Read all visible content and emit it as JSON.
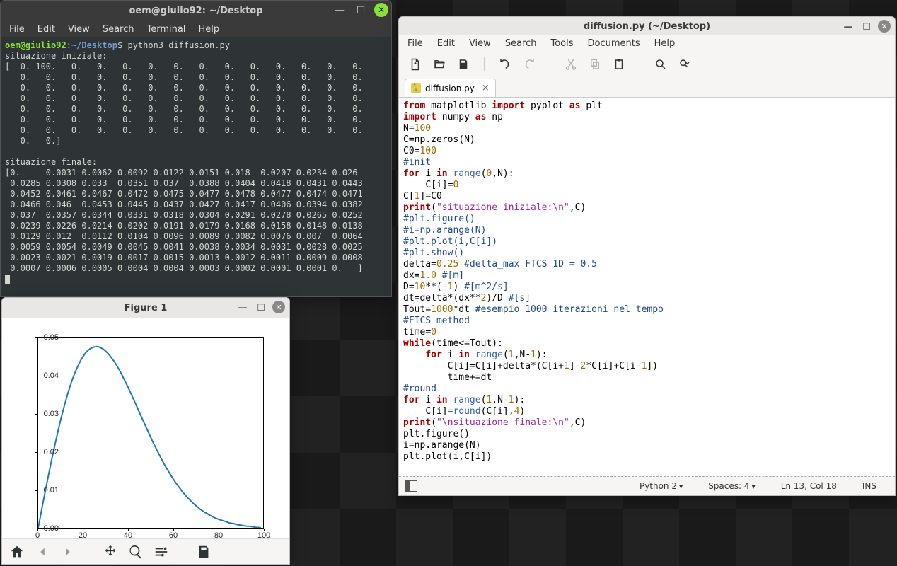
{
  "terminal": {
    "title": "oem@giulio92: ~/Desktop",
    "menu": [
      "File",
      "Edit",
      "View",
      "Search",
      "Terminal",
      "Help"
    ],
    "prompt_user": "oem@giulio92",
    "prompt_path": "~/Desktop",
    "prompt_symbol": "$",
    "command": "python3 diffusion.py",
    "out_label1": "situazione iniziale:",
    "init_array": "[  0. 100.   0.   0.   0.   0.   0.   0.   0.   0.   0.   0.   0.   0.\n   0.   0.   0.   0.   0.   0.   0.   0.   0.   0.   0.   0.   0.   0.\n   0.   0.   0.   0.   0.   0.   0.   0.   0.   0.   0.   0.   0.   0.\n   0.   0.   0.   0.   0.   0.   0.   0.   0.   0.   0.   0.   0.   0.\n   0.   0.   0.   0.   0.   0.   0.   0.   0.   0.   0.   0.   0.   0.\n   0.   0.   0.   0.   0.   0.   0.   0.   0.   0.   0.   0.   0.   0.\n   0.   0.   0.   0.   0.   0.   0.   0.   0.   0.   0.   0.   0.   0.\n   0.   0.]",
    "out_label2": "situazione finale:",
    "final_array": "[0.     0.0031 0.0062 0.0092 0.0122 0.0151 0.018  0.0207 0.0234 0.026\n 0.0285 0.0308 0.033  0.0351 0.037  0.0388 0.0404 0.0418 0.0431 0.0443\n 0.0452 0.0461 0.0467 0.0472 0.0475 0.0477 0.0478 0.0477 0.0474 0.0471\n 0.0466 0.046  0.0453 0.0445 0.0437 0.0427 0.0417 0.0406 0.0394 0.0382\n 0.037  0.0357 0.0344 0.0331 0.0318 0.0304 0.0291 0.0278 0.0265 0.0252\n 0.0239 0.0226 0.0214 0.0202 0.0191 0.0179 0.0168 0.0158 0.0148 0.0138\n 0.0129 0.012  0.0112 0.0104 0.0096 0.0089 0.0082 0.0076 0.007  0.0064\n 0.0059 0.0054 0.0049 0.0045 0.0041 0.0038 0.0034 0.0031 0.0028 0.0025\n 0.0023 0.0021 0.0019 0.0017 0.0015 0.0013 0.0012 0.0011 0.0009 0.0008\n 0.0007 0.0006 0.0005 0.0004 0.0004 0.0003 0.0002 0.0001 0.0001 0.   ]"
  },
  "chart_data": {
    "type": "line",
    "x": [
      0,
      1,
      2,
      3,
      4,
      5,
      6,
      7,
      8,
      9,
      10,
      11,
      12,
      13,
      14,
      15,
      16,
      17,
      18,
      19,
      20,
      21,
      22,
      23,
      24,
      25,
      26,
      27,
      28,
      29,
      30,
      31,
      32,
      33,
      34,
      35,
      36,
      37,
      38,
      39,
      40,
      41,
      42,
      43,
      44,
      45,
      46,
      47,
      48,
      49,
      50,
      51,
      52,
      53,
      54,
      55,
      56,
      57,
      58,
      59,
      60,
      61,
      62,
      63,
      64,
      65,
      66,
      67,
      68,
      69,
      70,
      71,
      72,
      73,
      74,
      75,
      76,
      77,
      78,
      79,
      80,
      81,
      82,
      83,
      84,
      85,
      86,
      87,
      88,
      89,
      90,
      91,
      92,
      93,
      94,
      95,
      96,
      97,
      98,
      99
    ],
    "y": [
      0,
      0.0031,
      0.0062,
      0.0092,
      0.0122,
      0.0151,
      0.018,
      0.0207,
      0.0234,
      0.026,
      0.0285,
      0.0308,
      0.033,
      0.0351,
      0.037,
      0.0388,
      0.0404,
      0.0418,
      0.0431,
      0.0443,
      0.0452,
      0.0461,
      0.0467,
      0.0472,
      0.0475,
      0.0477,
      0.0478,
      0.0477,
      0.0474,
      0.0471,
      0.0466,
      0.046,
      0.0453,
      0.0445,
      0.0437,
      0.0427,
      0.0417,
      0.0406,
      0.0394,
      0.0382,
      0.037,
      0.0357,
      0.0344,
      0.0331,
      0.0318,
      0.0304,
      0.0291,
      0.0278,
      0.0265,
      0.0252,
      0.0239,
      0.0226,
      0.0214,
      0.0202,
      0.0191,
      0.0179,
      0.0168,
      0.0158,
      0.0148,
      0.0138,
      0.0129,
      0.012,
      0.0112,
      0.0104,
      0.0096,
      0.0089,
      0.0082,
      0.0076,
      0.007,
      0.0064,
      0.0059,
      0.0054,
      0.0049,
      0.0045,
      0.0041,
      0.0038,
      0.0034,
      0.0031,
      0.0028,
      0.0025,
      0.0023,
      0.0021,
      0.0019,
      0.0017,
      0.0015,
      0.0013,
      0.0012,
      0.0011,
      0.0009,
      0.0008,
      0.0007,
      0.0006,
      0.0005,
      0.0004,
      0.0004,
      0.0003,
      0.0002,
      0.0001,
      0.0001,
      0
    ],
    "title": "Figure 1",
    "xlabel": "",
    "ylabel": "",
    "xlim": [
      0,
      100
    ],
    "ylim": [
      0,
      0.05
    ],
    "xticks": [
      0,
      20,
      40,
      60,
      80,
      100
    ],
    "yticks": [
      0.0,
      0.01,
      0.02,
      0.03,
      0.04,
      0.05
    ],
    "ytick_labels": [
      "0.00",
      "0.01",
      "0.02",
      "0.03",
      "0.04",
      "0.05"
    ],
    "xtick_labels": [
      "0",
      "20",
      "40",
      "60",
      "80",
      "100"
    ],
    "line_color": "#1f77b4"
  },
  "figure": {
    "title": "Figure 1",
    "toolbar_icons": [
      "home",
      "back",
      "forward",
      "move",
      "zoom",
      "config",
      "save"
    ]
  },
  "editor": {
    "title": "diffusion.py (~/Desktop)",
    "menu": [
      "File",
      "Edit",
      "View",
      "Search",
      "Tools",
      "Documents",
      "Help"
    ],
    "tab_label": "diffusion.py",
    "status": {
      "language": "Python 2",
      "indent": "Spaces: 4",
      "cursor": "Ln 13, Col 18",
      "insmode": "INS"
    },
    "code_tokens": [
      [
        [
          "kw",
          "from"
        ],
        [
          "sp",
          " "
        ],
        [
          "id",
          "matplotlib"
        ],
        [
          "sp",
          " "
        ],
        [
          "kw",
          "import"
        ],
        [
          "sp",
          " "
        ],
        [
          "id",
          "pyplot"
        ],
        [
          "sp",
          " "
        ],
        [
          "kw",
          "as"
        ],
        [
          "sp",
          " "
        ],
        [
          "id",
          "plt"
        ]
      ],
      [
        [
          "kw",
          "import"
        ],
        [
          "sp",
          " "
        ],
        [
          "id",
          "numpy"
        ],
        [
          "sp",
          " "
        ],
        [
          "kw",
          "as"
        ],
        [
          "sp",
          " "
        ],
        [
          "id",
          "np"
        ]
      ],
      [
        [
          "id",
          "N"
        ],
        [
          "op",
          "="
        ],
        [
          "num",
          "100"
        ]
      ],
      [
        [
          "id",
          "C"
        ],
        [
          "op",
          "="
        ],
        [
          "id",
          "np.zeros(N)"
        ]
      ],
      [
        [
          "id",
          "C0"
        ],
        [
          "op",
          "="
        ],
        [
          "num",
          "100"
        ]
      ],
      [
        [
          "cm",
          "#init"
        ]
      ],
      [
        [
          "kw",
          "for"
        ],
        [
          "sp",
          " "
        ],
        [
          "id",
          "i"
        ],
        [
          "sp",
          " "
        ],
        [
          "kw",
          "in"
        ],
        [
          "sp",
          " "
        ],
        [
          "bi",
          "range"
        ],
        [
          "op",
          "("
        ],
        [
          "num",
          "0"
        ],
        [
          "op",
          ",N):"
        ]
      ],
      [
        [
          "sp",
          "    "
        ],
        [
          "id",
          "C[i]"
        ],
        [
          "op",
          "="
        ],
        [
          "num",
          "0"
        ]
      ],
      [
        [
          "id",
          "C["
        ],
        [
          "num",
          "1"
        ],
        [
          "id",
          "]"
        ],
        [
          "op",
          "="
        ],
        [
          "id",
          "C0"
        ]
      ],
      [
        [
          "kw",
          "print"
        ],
        [
          "op",
          "("
        ],
        [
          "str",
          "\"situazione iniziale:\\n\""
        ],
        [
          "op",
          ",C)"
        ]
      ],
      [
        [
          "cm",
          "#plt.figure()"
        ]
      ],
      [
        [
          "cm",
          "#i=np.arange(N)"
        ]
      ],
      [
        [
          "cm",
          "#plt.plot(i,C[i])"
        ]
      ],
      [
        [
          "cm",
          "#plt.show()"
        ]
      ],
      [
        [
          "id",
          "delta"
        ],
        [
          "op",
          "="
        ],
        [
          "num",
          "0.25"
        ],
        [
          "sp",
          " "
        ],
        [
          "cm",
          "#delta_max FTCS 1D = 0.5"
        ]
      ],
      [
        [
          "id",
          "dx"
        ],
        [
          "op",
          "="
        ],
        [
          "num",
          "1.0"
        ],
        [
          "sp",
          " "
        ],
        [
          "cm",
          "#[m]"
        ]
      ],
      [
        [
          "id",
          "D"
        ],
        [
          "op",
          "="
        ],
        [
          "num",
          "10"
        ],
        [
          "op",
          "**(-"
        ],
        [
          "num",
          "1"
        ],
        [
          "op",
          ")"
        ],
        [
          "sp",
          " "
        ],
        [
          "cm",
          "#[m^2/s]"
        ]
      ],
      [
        [
          "id",
          "dt"
        ],
        [
          "op",
          "="
        ],
        [
          "id",
          "delta*(dx**"
        ],
        [
          "num",
          "2"
        ],
        [
          "id",
          ")/D"
        ],
        [
          "sp",
          " "
        ],
        [
          "cm",
          "#[s]"
        ]
      ],
      [
        [
          "id",
          "Tout"
        ],
        [
          "op",
          "="
        ],
        [
          "num",
          "1000"
        ],
        [
          "id",
          "*dt"
        ],
        [
          "sp",
          " "
        ],
        [
          "cm",
          "#esempio 1000 iterazioni nel tempo"
        ]
      ],
      [
        [
          "cm",
          "#FTCS method"
        ]
      ],
      [
        [
          "id",
          "time"
        ],
        [
          "op",
          "="
        ],
        [
          "num",
          "0"
        ]
      ],
      [
        [
          "kw",
          "while"
        ],
        [
          "op",
          "(time<=Tout):"
        ]
      ],
      [
        [
          "sp",
          "    "
        ],
        [
          "kw",
          "for"
        ],
        [
          "sp",
          " "
        ],
        [
          "id",
          "i"
        ],
        [
          "sp",
          " "
        ],
        [
          "kw",
          "in"
        ],
        [
          "sp",
          " "
        ],
        [
          "bi",
          "range"
        ],
        [
          "op",
          "("
        ],
        [
          "num",
          "1"
        ],
        [
          "op",
          ",N-"
        ],
        [
          "num",
          "1"
        ],
        [
          "op",
          "):"
        ]
      ],
      [
        [
          "sp",
          "        "
        ],
        [
          "id",
          "C[i]"
        ],
        [
          "op",
          "="
        ],
        [
          "id",
          "C[i]+delta*(C[i+"
        ],
        [
          "num",
          "1"
        ],
        [
          "id",
          "]-"
        ],
        [
          "num",
          "2"
        ],
        [
          "id",
          "*C[i]+C[i-"
        ],
        [
          "num",
          "1"
        ],
        [
          "id",
          "])"
        ]
      ],
      [
        [
          "sp",
          "        "
        ],
        [
          "id",
          "time+=dt"
        ]
      ],
      [
        [
          "cm",
          "#round"
        ]
      ],
      [
        [
          "kw",
          "for"
        ],
        [
          "sp",
          " "
        ],
        [
          "id",
          "i"
        ],
        [
          "sp",
          " "
        ],
        [
          "kw",
          "in"
        ],
        [
          "sp",
          " "
        ],
        [
          "bi",
          "range"
        ],
        [
          "op",
          "("
        ],
        [
          "num",
          "1"
        ],
        [
          "op",
          ",N-"
        ],
        [
          "num",
          "1"
        ],
        [
          "op",
          "):"
        ]
      ],
      [
        [
          "sp",
          "    "
        ],
        [
          "id",
          "C[i]"
        ],
        [
          "op",
          "="
        ],
        [
          "bi",
          "round"
        ],
        [
          "op",
          "(C[i],"
        ],
        [
          "num",
          "4"
        ],
        [
          "op",
          ")"
        ]
      ],
      [
        [
          "kw",
          "print"
        ],
        [
          "op",
          "("
        ],
        [
          "str",
          "\"\\nsituazione finale:\\n\""
        ],
        [
          "op",
          ",C)"
        ]
      ],
      [
        [
          "id",
          "plt.figure()"
        ]
      ],
      [
        [
          "id",
          "i"
        ],
        [
          "op",
          "="
        ],
        [
          "id",
          "np.arange(N)"
        ]
      ],
      [
        [
          "id",
          "plt.plot(i,C[i])"
        ]
      ]
    ]
  }
}
